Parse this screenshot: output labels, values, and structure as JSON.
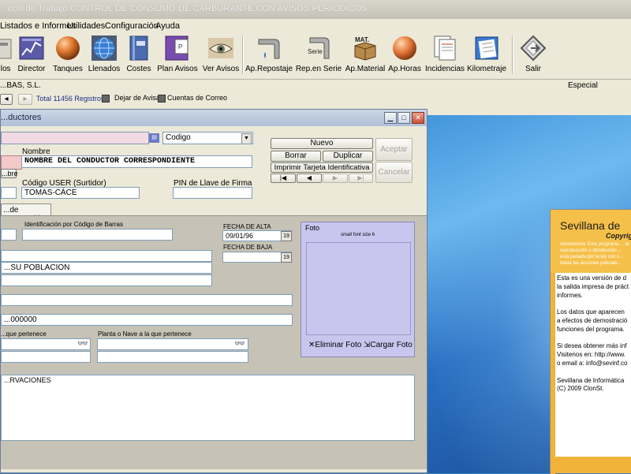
{
  "window": {
    "title": "...ccol de Trabajo CONTROL DE CONSUMO DE CARBURANTE CON AVISOS PERIODICOS"
  },
  "menu": [
    "Listados e Informes",
    "Utilidades",
    "Configuración",
    "Ayuda"
  ],
  "toolbar": [
    {
      "label": "...los",
      "icon": "cut-off-icon"
    },
    {
      "label": "Director",
      "icon": "chart-icon"
    },
    {
      "label": "Tanques",
      "icon": "sphere-icon"
    },
    {
      "label": "Llenados",
      "icon": "globe-grid-icon"
    },
    {
      "label": "Costes",
      "icon": "book-icon"
    },
    {
      "label": "Plan Avisos",
      "icon": "document-icon"
    },
    {
      "label": "Ver Avisos",
      "icon": "eye-icon"
    },
    {
      "label": "Ap.Repostaje",
      "icon": "pipe-icon"
    },
    {
      "label": "Rep.en Serie",
      "icon": "serie-pipe-icon",
      "text": "Serie"
    },
    {
      "label": "Ap.Material",
      "icon": "material-box-icon",
      "text": "MAT."
    },
    {
      "label": "Ap.Horas",
      "icon": "orange-ball-icon"
    },
    {
      "label": "Incidencias",
      "icon": "documents-icon"
    },
    {
      "label": "Kilometraje",
      "icon": "checklist-icon"
    },
    {
      "label": "Salir",
      "icon": "exit-icon"
    }
  ],
  "infobar": {
    "company": "...BAS, S.L.",
    "section": "Especial"
  },
  "navbar": {
    "total": "Total 11456 Registros",
    "check1": "Dejar de Avisar",
    "check2": "Cuentas de Correo"
  },
  "dialog": {
    "title": "...ductores",
    "search_label": "Codigo",
    "nombre_label": "Nombre",
    "nombre_value": "NOMBRE DEL CONDUCTOR CORRESPONDIENTE",
    "nombre_btn": "...bre",
    "codigo_user_label": "Código USER (Surtidor)",
    "codigo_user_value": "TOMAS-CÁCE",
    "pin_label": "PIN de Llave de Firma",
    "buttons": {
      "nuevo": "Nuevo",
      "borrar": "Borrar",
      "duplicar": "Duplicar",
      "imprimir": "Imprimir Tarjeta Identificativa",
      "aceptar": "Aceptar",
      "cancelar": "Cancelar"
    },
    "tab_label": "...de Navegación",
    "ident_label": "Identificación por Código de Barras",
    "fecha_alta_label": "FECHA DE ALTA",
    "fecha_alta_value": "09/01/96",
    "fecha_baja_label": "FECHA DE BAJA",
    "poblacion_value": "...SU POBLACION",
    "phone_value": "...000000",
    "pertenece_label": "...que pertenece",
    "planta_label": "Planta o Nave a la que pertenece",
    "observ_value": "...RVACIONES",
    "foto_label": "Foto",
    "foto_caption": "small font size 6",
    "eliminar_foto": "Eliminar Foto",
    "cargar_foto": "Cargar Foto"
  },
  "sidepanel": {
    "title": "Sevillana de",
    "subtitle": "Copyrig",
    "warning": "Advertencia: Este programa ... la reproducción o distribución ... está penada por la ley con s... todas las acciones judiciale...",
    "lines": [
      "Esta es una versión de d",
      "la salida impresa de práct",
      "informes.",
      "",
      "Los datos que aparecen",
      "a efectos de demostració",
      "funciones del programa.",
      "",
      "Si desea obtener más inf",
      "Visitenos en: http://www.",
      "o email a: info@sevinf.co",
      "",
      "Sevillana de Informática",
      "(C) 2009 ClonSt."
    ]
  },
  "colors": {
    "accent": "#f5c04a",
    "desktop": "#3b7fc4",
    "foto_bg": "#c8c6ee"
  }
}
